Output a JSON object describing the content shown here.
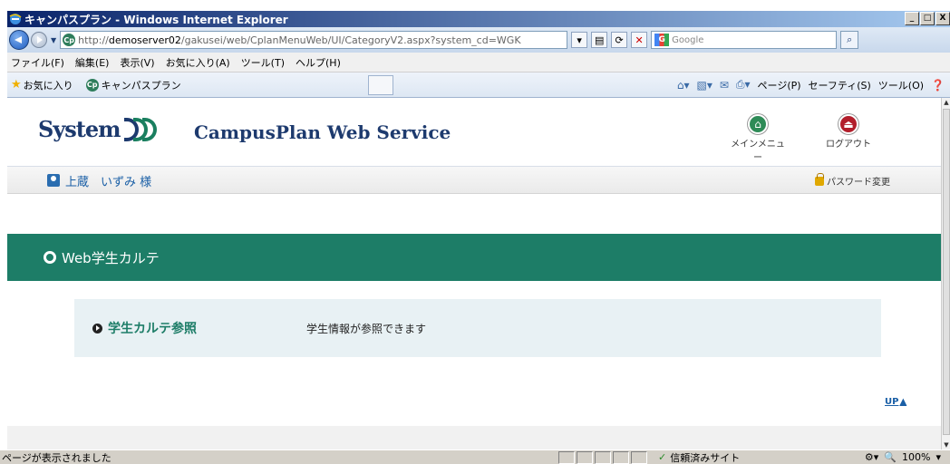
{
  "window": {
    "title": "キャンパスプラン - Windows Internet Explorer",
    "min_label": "_",
    "max_label": "□",
    "close_label": "X"
  },
  "address_bar": {
    "url_prefix": "http://",
    "url_host": "demoserver02",
    "url_path": "/gakusei/web/CplanMenuWeb/UI/CategoryV2.aspx?system_cd=WGK",
    "search_placeholder": "Google"
  },
  "menu": [
    "ファイル(F)",
    "編集(E)",
    "表示(V)",
    "お気に入り(A)",
    "ツール(T)",
    "ヘルプ(H)"
  ],
  "favorites_bar": {
    "favorites_label": "お気に入り",
    "tab_title": "キャンパスプラン"
  },
  "command_bar": [
    "ページ(P)",
    "セーフティ(S)",
    "ツール(O)"
  ],
  "header": {
    "logo_text": "System",
    "service_title": "CampusPlan Web Service",
    "main_menu_label": "メインメニュー",
    "logout_label": "ログアウト"
  },
  "user": {
    "name": "上蔵　いずみ 様",
    "password_change_label": "パスワード変更"
  },
  "section": {
    "title": "Web学生カルテ"
  },
  "card": {
    "link_label": "学生カルテ参照",
    "description": "学生情報が参照できます"
  },
  "up_link": "UP",
  "status_bar": {
    "text": "ページが表示されました",
    "zone": "信頼済みサイト",
    "zoom": "100%"
  },
  "colors": {
    "accent": "#1d7d67",
    "link": "#1a5fa6",
    "card_bg": "#e8f1f4"
  }
}
